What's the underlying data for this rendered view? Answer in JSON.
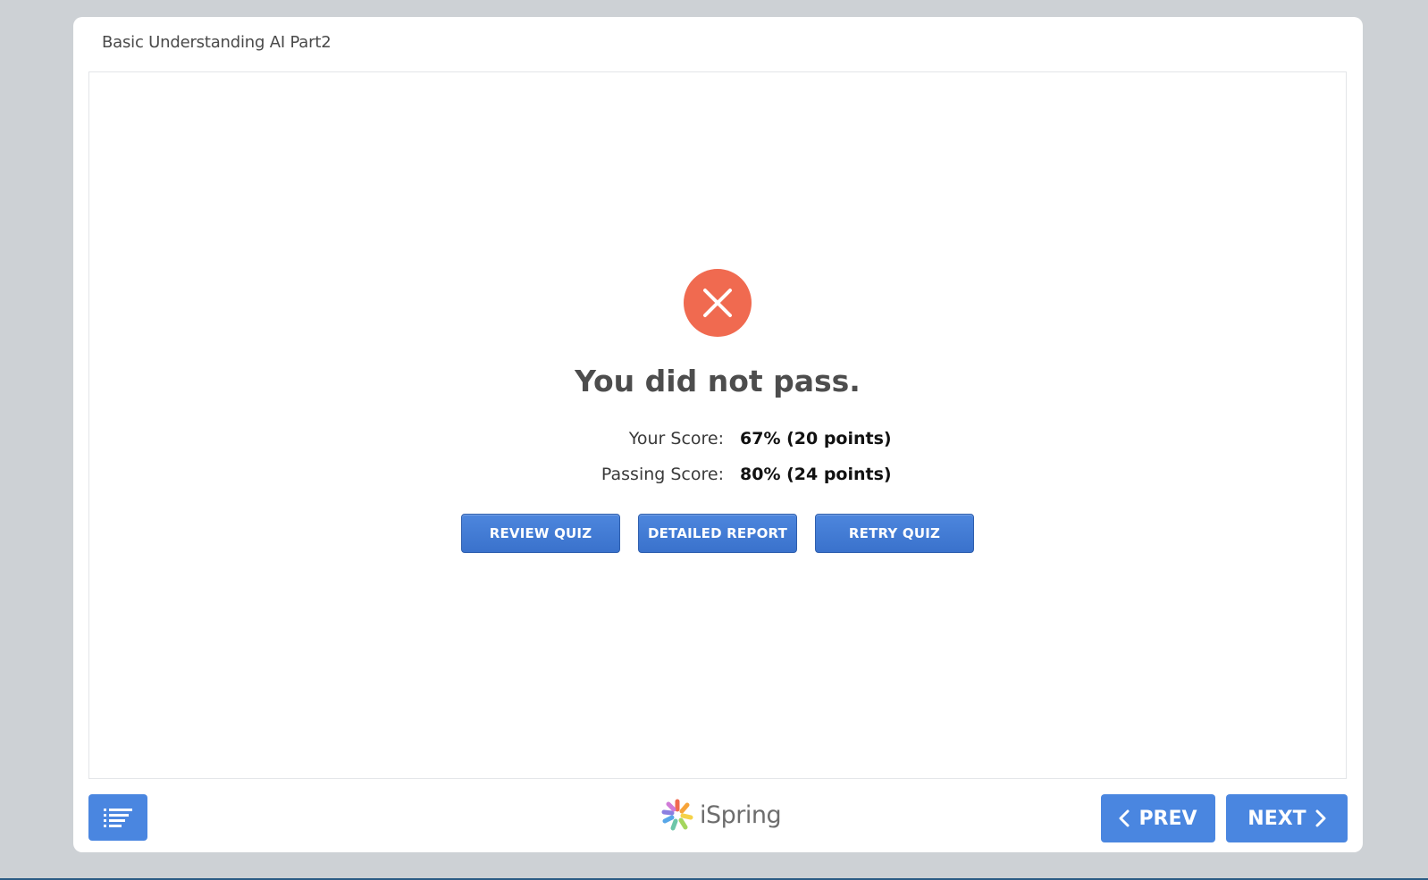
{
  "player": {
    "title": "Basic Understanding AI Part2"
  },
  "result": {
    "icon": "close-x-icon",
    "headline": "You did not pass.",
    "your_score_label": "Your Score:",
    "your_score_value": "67% (20 points)",
    "passing_score_label": "Passing Score:",
    "passing_score_value": "80% (24 points)"
  },
  "actions": {
    "review_label": "REVIEW QUIZ",
    "report_label": "DETAILED REPORT",
    "retry_label": "RETRY QUIZ"
  },
  "footer": {
    "toc_icon": "list-icon",
    "brand": "iSpring",
    "prev_label": "PREV",
    "next_label": "NEXT"
  },
  "colors": {
    "background": "#cdd1d5",
    "accent": "#4a86e0",
    "fail": "#f06a50",
    "panel": "#ffffff"
  }
}
